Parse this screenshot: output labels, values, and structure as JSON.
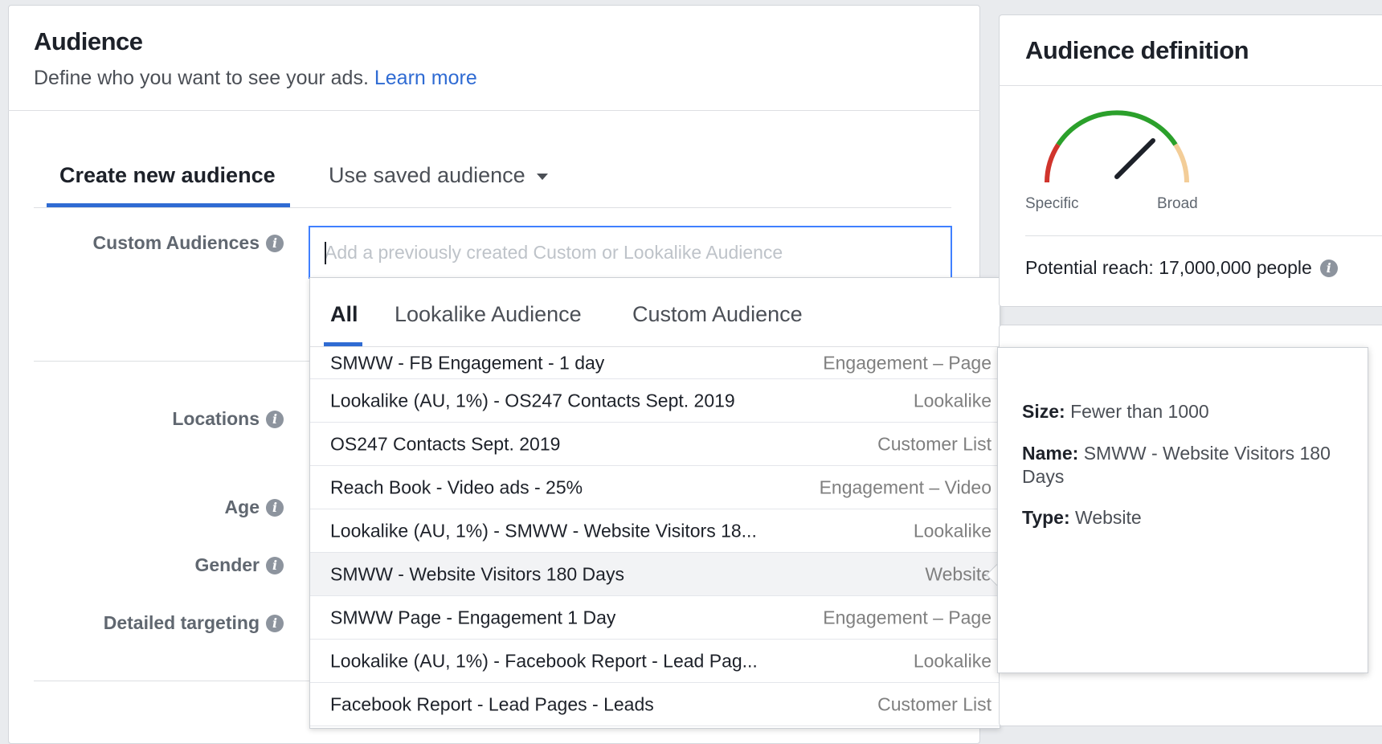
{
  "audience": {
    "title": "Audience",
    "description": "Define who you want to see your ads.",
    "learn_more": "Learn more"
  },
  "tabs": {
    "create": "Create new audience",
    "saved": "Use saved audience"
  },
  "fields": {
    "custom_audiences": "Custom Audiences",
    "locations": "Locations",
    "age": "Age",
    "gender": "Gender",
    "detailed_targeting": "Detailed targeting"
  },
  "search": {
    "placeholder": "Add a previously created Custom or Lookalike Audience"
  },
  "dropdown": {
    "tabs": {
      "all": "All",
      "lookalike": "Lookalike Audience",
      "custom": "Custom Audience"
    },
    "rows": [
      {
        "name": "SMWW - FB Engagement - 1 day",
        "type": "Engagement – Page"
      },
      {
        "name": "Lookalike (AU, 1%) - OS247 Contacts Sept. 2019",
        "type": "Lookalike"
      },
      {
        "name": "OS247 Contacts Sept. 2019",
        "type": "Customer List"
      },
      {
        "name": "Reach Book - Video ads - 25%",
        "type": "Engagement – Video"
      },
      {
        "name": "Lookalike (AU, 1%) - SMWW - Website Visitors 18...",
        "type": "Lookalike"
      },
      {
        "name": "SMWW - Website Visitors 180 Days",
        "type": "Website"
      },
      {
        "name": "SMWW Page - Engagement 1 Day",
        "type": "Engagement – Page"
      },
      {
        "name": "Lookalike (AU, 1%) - Facebook Report - Lead Pag...",
        "type": "Lookalike"
      },
      {
        "name": "Facebook Report - Lead Pages - Leads",
        "type": "Customer List"
      }
    ]
  },
  "definition": {
    "title": "Audience definition",
    "specific": "Specific",
    "broad": "Broad",
    "reach": "Potential reach: 17,000,000 people"
  },
  "tooltip": {
    "size_label": "Size:",
    "size_value": "Fewer than 1000",
    "name_label": "Name:",
    "name_value": "SMWW - Website Visitors 180 Days",
    "type_label": "Type:",
    "type_value": "Website"
  },
  "colors": {
    "accent": "#2f6bd3",
    "gauge_red": "#d0342c",
    "gauge_green": "#2ba02b",
    "gauge_beige": "#f3cd98"
  }
}
